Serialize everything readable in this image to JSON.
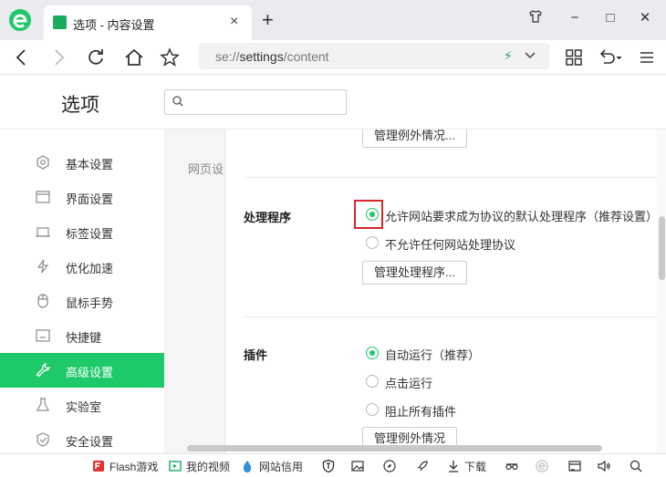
{
  "tab": {
    "title": "选项 - 内容设置",
    "close": "×"
  },
  "newtab": "+",
  "window": {
    "skin": "👕",
    "minimize": "−",
    "maximize": "□",
    "close": "✕"
  },
  "address": {
    "prefix": "se://",
    "highlight": "settings",
    "suffix": "/content"
  },
  "header": {
    "title": "选项",
    "search_placeholder": ""
  },
  "sidebar": {
    "items": [
      {
        "label": "基本设置",
        "icon": "gear-icon"
      },
      {
        "label": "界面设置",
        "icon": "window-icon"
      },
      {
        "label": "标签设置",
        "icon": "tab-icon"
      },
      {
        "label": "优化加速",
        "icon": "lightning-icon"
      },
      {
        "label": "鼠标手势",
        "icon": "mouse-icon"
      },
      {
        "label": "快捷键",
        "icon": "keyboard-icon"
      },
      {
        "label": "高级设置",
        "icon": "wrench-icon"
      },
      {
        "label": "实验室",
        "icon": "flask-icon"
      },
      {
        "label": "安全设置",
        "icon": "shield-icon"
      }
    ],
    "active_index": 6
  },
  "content": {
    "section_label": "网页设置",
    "top_button": "管理例外情况...",
    "handler": {
      "title": "处理程序",
      "options": [
        {
          "label": "允许网站要求成为协议的默认处理程序（推荐设置）",
          "checked": true
        },
        {
          "label": "不允许任何网站处理协议",
          "checked": false
        }
      ],
      "button": "管理处理程序..."
    },
    "plugins": {
      "title": "插件",
      "options": [
        {
          "label": "自动运行（推荐）",
          "checked": true
        },
        {
          "label": "点击运行",
          "checked": false
        },
        {
          "label": "阻止所有插件",
          "checked": false
        }
      ],
      "button": "管理例外情况"
    }
  },
  "statusbar": {
    "flash": "Flash游戏",
    "video": "我的视频",
    "credit": "网站信用",
    "download": "下载"
  },
  "colors": {
    "accent": "#1ec969",
    "highlight": "#d6262c"
  }
}
